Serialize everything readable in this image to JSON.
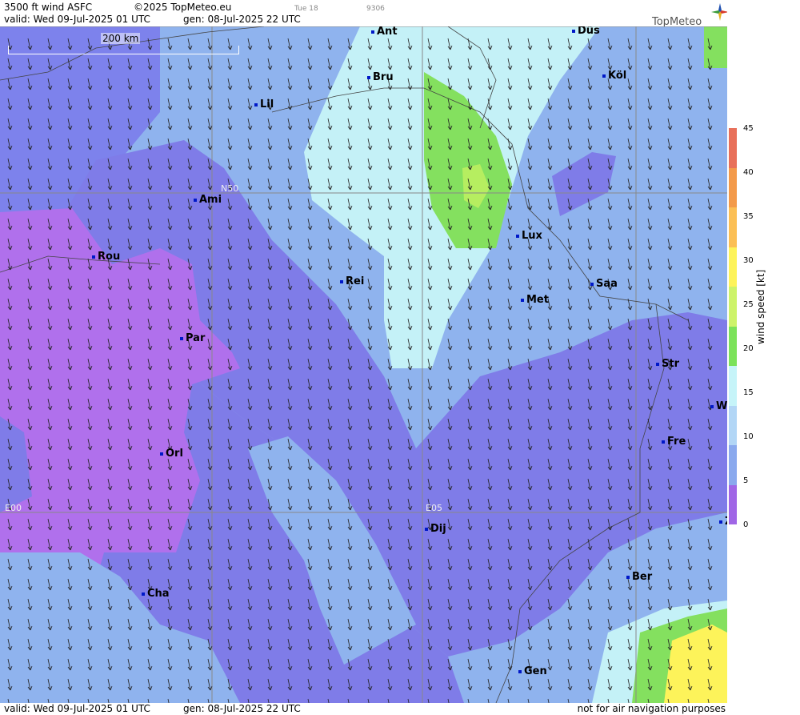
{
  "header": {
    "title": "3500 ft wind ASFC",
    "copyright": "©2025 TopMeteo.eu",
    "day_tag": "Tue 18",
    "code": "9306",
    "valid": "valid:  Wed  09-Jul-2025  01 UTC",
    "gen": "gen: 08-Jul-2025 22 UTC",
    "brand": "TopMeteo"
  },
  "map": {
    "scale_label": "200 km",
    "grid_labels": {
      "n50": "N50",
      "e00": "E00",
      "e05": "E05"
    },
    "cities": [
      {
        "name": "Ant"
      },
      {
        "name": "Düs"
      },
      {
        "name": "Bru"
      },
      {
        "name": "Köl"
      },
      {
        "name": "Lil"
      },
      {
        "name": "Ami"
      },
      {
        "name": "Rou"
      },
      {
        "name": "Lux"
      },
      {
        "name": "Rei"
      },
      {
        "name": "Saa"
      },
      {
        "name": "Met"
      },
      {
        "name": "Par"
      },
      {
        "name": "Str"
      },
      {
        "name": "W"
      },
      {
        "name": "Fre"
      },
      {
        "name": "Orl"
      },
      {
        "name": "Dij"
      },
      {
        "name": "Z"
      },
      {
        "name": "Ber"
      },
      {
        "name": "Cha"
      },
      {
        "name": "Gen"
      }
    ],
    "wind_direction": "south (arrows pointing down / slightly down-right)"
  },
  "footer": {
    "valid": "valid:  Wed  09-Jul-2025  01 UTC",
    "gen": "gen: 08-Jul-2025 22 UTC",
    "disclaimer": "not for air navigation purposes"
  },
  "legend": {
    "label": "wind  speed  [kt]",
    "ticks": [
      "45",
      "40",
      "35",
      "30",
      "25",
      "20",
      "15",
      "10",
      "5",
      "0"
    ],
    "colors": [
      "#e8705a",
      "#f39a4a",
      "#fbbf55",
      "#fdf35a",
      "#cdf36a",
      "#7be25a",
      "#c6f4f9",
      "#b2d6f6",
      "#8aa9ee",
      "#a066e6"
    ]
  }
}
